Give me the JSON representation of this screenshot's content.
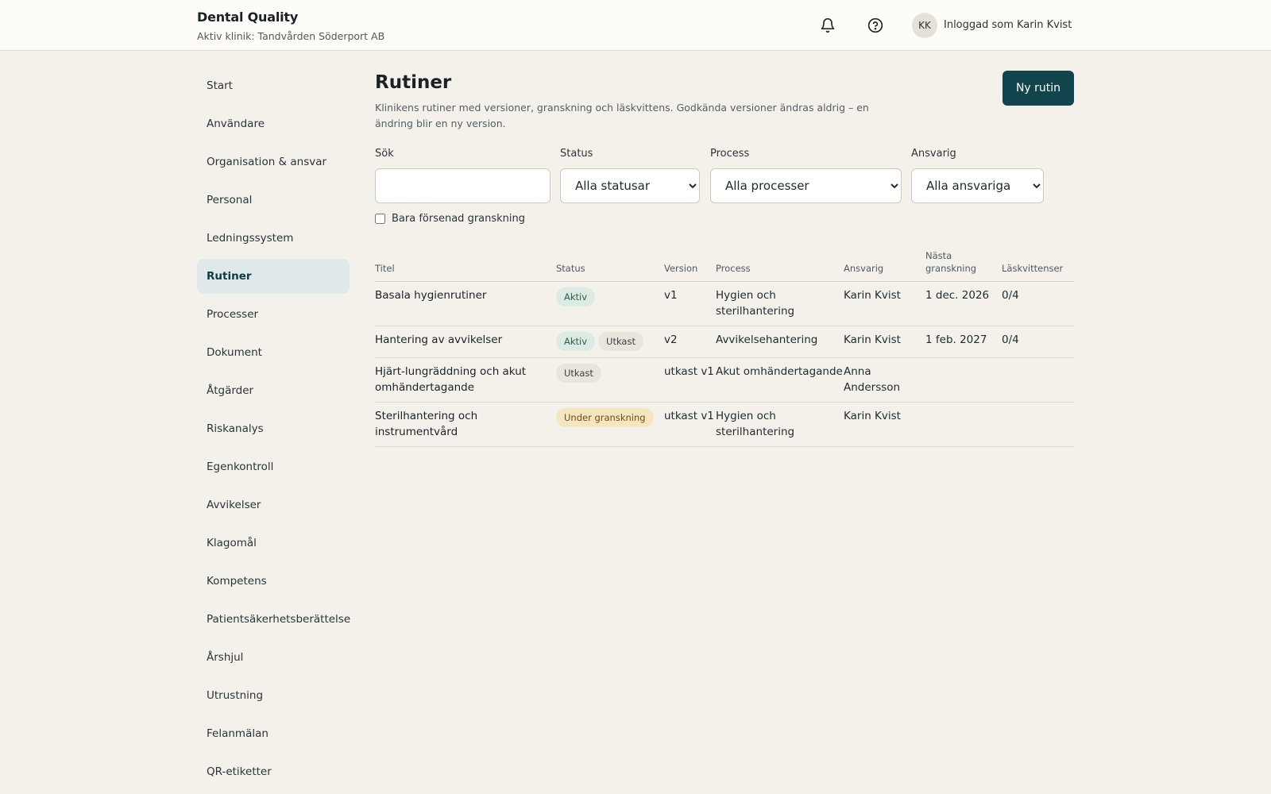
{
  "header": {
    "app_title": "Dental Quality",
    "active_clinic": "Aktiv klinik: Tandvården Söderport AB",
    "bell_icon": "bell-icon",
    "help_icon": "help-circle-icon",
    "avatar_initials": "KK",
    "user_label": "Inloggad som Karin Kvist"
  },
  "sidebar": {
    "items": [
      {
        "label": "Start"
      },
      {
        "label": "Användare"
      },
      {
        "label": "Organisation & ansvar"
      },
      {
        "label": "Personal"
      },
      {
        "label": "Ledningssystem"
      },
      {
        "label": "Rutiner",
        "active": true
      },
      {
        "label": "Processer"
      },
      {
        "label": "Dokument"
      },
      {
        "label": "Åtgärder"
      },
      {
        "label": "Riskanalys"
      },
      {
        "label": "Egenkontroll"
      },
      {
        "label": "Avvikelser"
      },
      {
        "label": "Klagomål"
      },
      {
        "label": "Kompetens"
      },
      {
        "label": "Patientsäkerhetsberättelse"
      },
      {
        "label": "Årshjul"
      },
      {
        "label": "Utrustning"
      },
      {
        "label": "Felanmälan"
      },
      {
        "label": "QR-etiketter"
      }
    ]
  },
  "main": {
    "title": "Rutiner",
    "description": "Klinikens rutiner med versioner, granskning och läskvittens. Godkända versioner ändras aldrig – en ändring blir en ny version.",
    "new_button": "Ny rutin",
    "filters": {
      "search_label": "Sök",
      "search_value": "",
      "status_label": "Status",
      "status_value": "Alla statusar",
      "process_label": "Process",
      "process_value": "Alla processer",
      "owner_label": "Ansvarig",
      "owner_value": "Alla ansvariga",
      "overdue_label": "Bara försenad granskning",
      "overdue_checked": false
    },
    "table": {
      "headers": {
        "title": "Titel",
        "status": "Status",
        "version": "Version",
        "process": "Process",
        "owner": "Ansvarig",
        "next_review": "Nästa granskning",
        "read_receipts": "Läskvittenser"
      },
      "rows": [
        {
          "title": "Basala hygienrutiner",
          "badges": [
            {
              "text": "Aktiv",
              "kind": "aktiv"
            }
          ],
          "version": "v1",
          "process": "Hygien och sterilhantering",
          "owner": "Karin Kvist",
          "next_review": "1 dec. 2026",
          "read_receipts": "0/4"
        },
        {
          "title": "Hantering av avvikelser",
          "badges": [
            {
              "text": "Aktiv",
              "kind": "aktiv"
            },
            {
              "text": "Utkast",
              "kind": "utkast"
            }
          ],
          "version": "v2",
          "process": "Avvikelsehantering",
          "owner": "Karin Kvist",
          "next_review": "1 feb. 2027",
          "read_receipts": "0/4"
        },
        {
          "title": "Hjärt-lungräddning och akut omhändertagande",
          "badges": [
            {
              "text": "Utkast",
              "kind": "utkast"
            }
          ],
          "version": "utkast v1",
          "process": "Akut omhändertagande",
          "owner": "Anna Andersson",
          "next_review": "",
          "read_receipts": ""
        },
        {
          "title": "Sterilhantering och instrumentvård",
          "badges": [
            {
              "text": "Under granskning",
              "kind": "review"
            }
          ],
          "version": "utkast v1",
          "process": "Hygien och sterilhantering",
          "owner": "Karin Kvist",
          "next_review": "",
          "read_receipts": ""
        }
      ]
    }
  }
}
